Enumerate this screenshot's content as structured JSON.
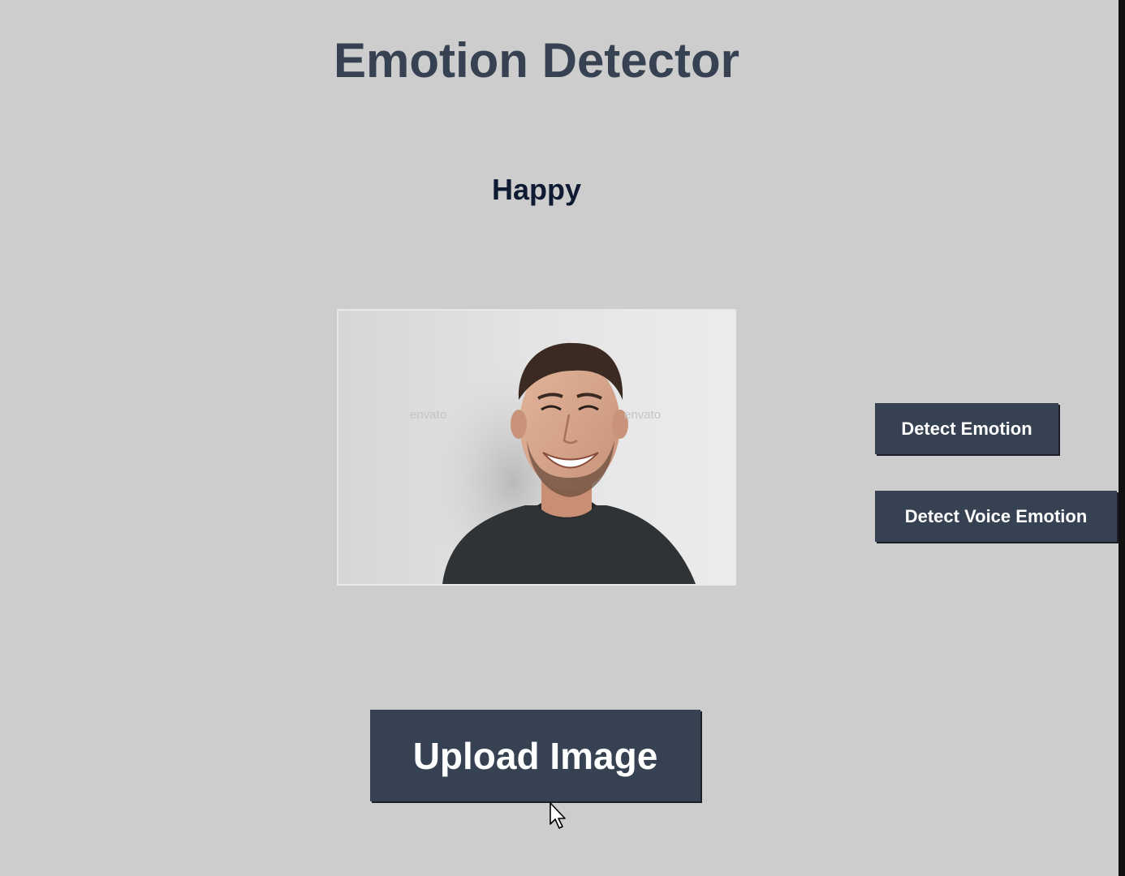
{
  "app": {
    "title": "Emotion Detector",
    "result_label": "Happy"
  },
  "image": {
    "subject": "smiling man in dark t-shirt",
    "watermark_left": "envato",
    "watermark_right": "envato"
  },
  "buttons": {
    "detect_emotion": "Detect Emotion",
    "detect_voice_emotion": "Detect Voice Emotion",
    "upload_image": "Upload Image"
  },
  "colors": {
    "background": "#cdcdcd",
    "button_bg": "#364152",
    "button_text": "#ffffff",
    "title_text": "#364152",
    "result_text": "#0f1a33"
  },
  "icons": {
    "cursor": "mouse-pointer-icon"
  }
}
